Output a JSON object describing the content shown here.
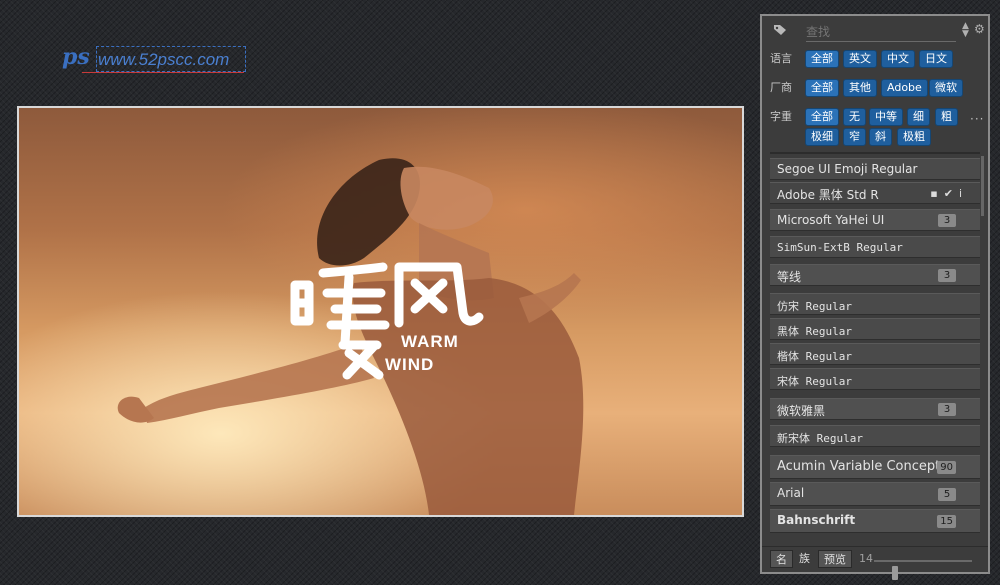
{
  "watermark": {
    "text": "www.52pscc.com"
  },
  "canvas": {
    "logo": {
      "chinese": "暖风",
      "line1": "WARM",
      "line2": "WIND"
    }
  },
  "panel": {
    "search": {
      "placeholder": "查找"
    },
    "filters": [
      {
        "label": "语言",
        "options": [
          "全部",
          "英文",
          "中文",
          "日文"
        ],
        "selected": "全部"
      },
      {
        "label": "厂商",
        "options": [
          "全部",
          "其他",
          "Adobe",
          "微软"
        ],
        "selected": "全部"
      },
      {
        "label": "字重",
        "options": [
          "全部",
          "无",
          "中等",
          "细",
          "粗",
          "极细",
          "窄",
          "斜",
          "极粗"
        ],
        "selected": "全部"
      }
    ],
    "fonts": [
      {
        "name": "Segoe UI Emoji Regular",
        "count": ""
      },
      {
        "name": "Adobe 黑体 Std R",
        "count": ""
      },
      {
        "name": "Microsoft YaHei UI",
        "count": "3"
      },
      {
        "name": "SimSun-ExtB Regular",
        "count": ""
      },
      {
        "name": "等线",
        "count": "3"
      },
      {
        "name": "仿宋 Regular",
        "count": ""
      },
      {
        "name": "黑体 Regular",
        "count": ""
      },
      {
        "name": "楷体 Regular",
        "count": ""
      },
      {
        "name": "宋体 Regular",
        "count": ""
      },
      {
        "name": "微软雅黑",
        "count": "3"
      },
      {
        "name": "新宋体 Regular",
        "count": ""
      },
      {
        "name": "Acumin Variable Concept",
        "count": "90"
      },
      {
        "name": "Arial",
        "count": "5"
      },
      {
        "name": "Bahnschrift",
        "count": "15"
      }
    ],
    "bottom": {
      "btn_name": "名",
      "btn_family": "族",
      "btn_preview": "预览",
      "size": "14",
      "size_level": 0.2
    }
  }
}
